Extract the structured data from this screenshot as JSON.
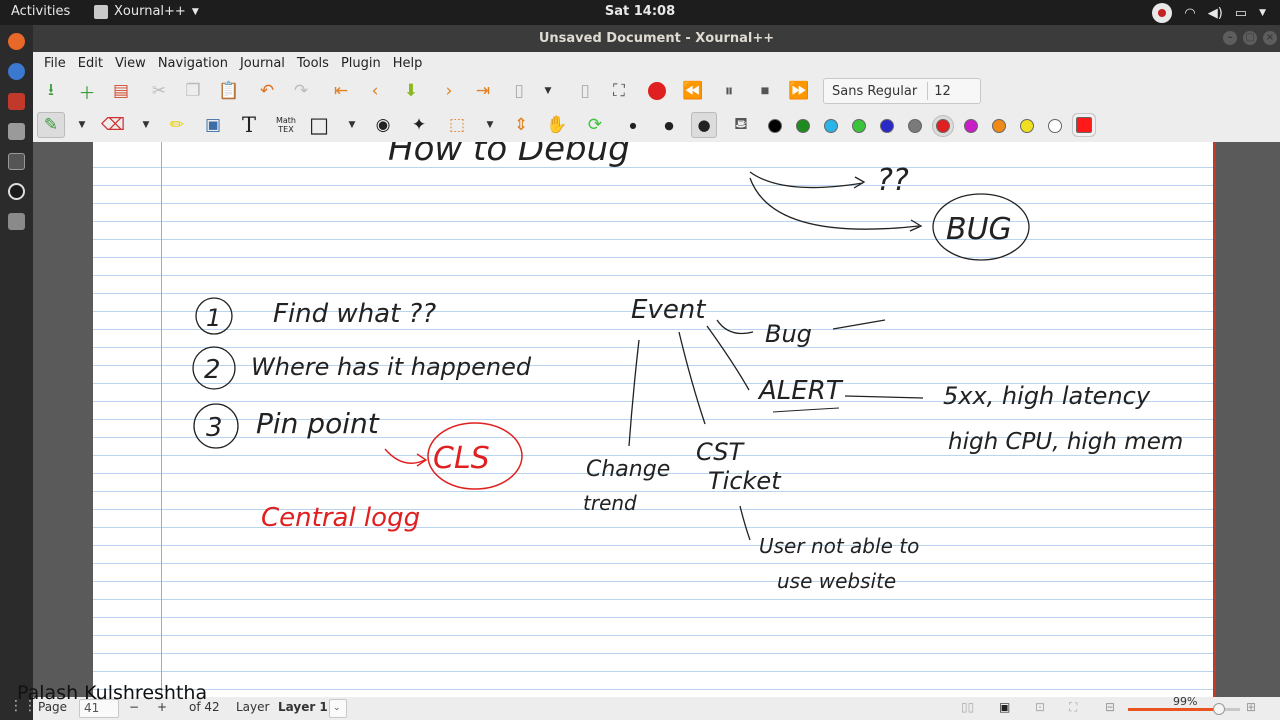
{
  "topbar": {
    "activities": "Activities",
    "app_name": "Xournal++",
    "clock": "Sat 14:08",
    "tray": {
      "wifi": "wifi-icon",
      "volume": "volume-icon",
      "power": "power-icon"
    }
  },
  "window": {
    "title": "Unsaved Document - Xournal++"
  },
  "menu": [
    "File",
    "Edit",
    "View",
    "Navigation",
    "Journal",
    "Tools",
    "Plugin",
    "Help"
  ],
  "toolbar1": {
    "font_name": "Sans Regular",
    "font_size": "12",
    "record_color": "#e02020"
  },
  "toolbar2": {
    "math_tex": {
      "line1": "Math",
      "line2": "TEX"
    },
    "colors": [
      "#000000",
      "#1f8a1f",
      "#2ab4e8",
      "#3bc43b",
      "#2a2ac8",
      "#7a7a7a",
      "#e02020",
      "#c81ec8",
      "#f08a16",
      "#f0e020",
      "#ffffff",
      "#ff1a1a"
    ],
    "selected_color": "#e02020"
  },
  "notes": {
    "header_partial": "How to Debug",
    "qq": "??",
    "bug_circle": "BUG",
    "step1": "Find what ??",
    "step2": "Where has it happened",
    "step3": "Pin point",
    "num1": "1",
    "num2": "2",
    "num3": "3",
    "cls": "CLS",
    "central_logging": "Central logg",
    "event": "Event",
    "bug": "Bug",
    "alert": "ALERT",
    "alert_detail1": "5xx, high latency",
    "alert_detail2": "high CPU, high mem",
    "change": "Change",
    "trend": "trend",
    "cst": "CST",
    "ticket": "Ticket",
    "user_line1": "User not able to",
    "user_line2": "use website"
  },
  "status": {
    "page_label": "Page",
    "page_value": "41",
    "of_label": "of 42",
    "layer_label": "Layer",
    "layer_value": "Layer 1",
    "zoom": "99%",
    "zoom_fraction": 0.99
  },
  "watermark": "Palash Kulshreshtha"
}
